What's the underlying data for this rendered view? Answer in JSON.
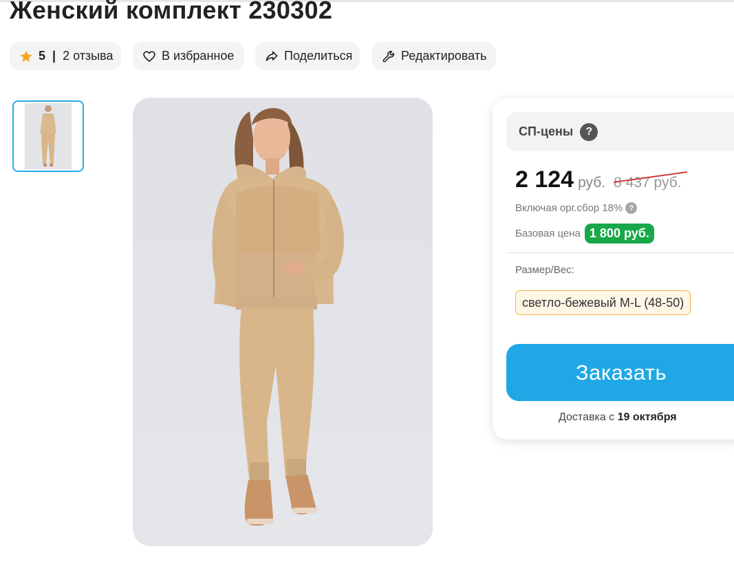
{
  "product": {
    "title": "Женский комплект 230302"
  },
  "actions": {
    "rating_value": "5",
    "rating_sep": "|",
    "reviews": "2 отзыва",
    "favorite": "В избранное",
    "share": "Поделиться",
    "edit": "Редактировать"
  },
  "icons": {
    "rating": "star-icon",
    "favorite": "heart-icon",
    "share": "share-icon",
    "edit": "wrench-icon",
    "help": "question-icon"
  },
  "pricing": {
    "header": "СП-цены",
    "help_glyph": "?",
    "price": "2 124",
    "currency": "руб.",
    "old_price": "8 437 руб.",
    "fee_note": "Включая орг.сбор 18%",
    "base_label": "Базовая цена",
    "base_price": "1 800 руб."
  },
  "size": {
    "label": "Размер/Вес:",
    "selected": "светло-бежевый M-L (48-50)"
  },
  "order": {
    "button": "Заказать",
    "delivery_prefix": "Доставка с",
    "delivery_date": "19 октября"
  },
  "colors": {
    "accent": "#1fa8e5",
    "base_badge": "#18a84a",
    "strike": "#d33a3a",
    "star": "#f5a623",
    "thumb_border": "#29a8e7"
  }
}
